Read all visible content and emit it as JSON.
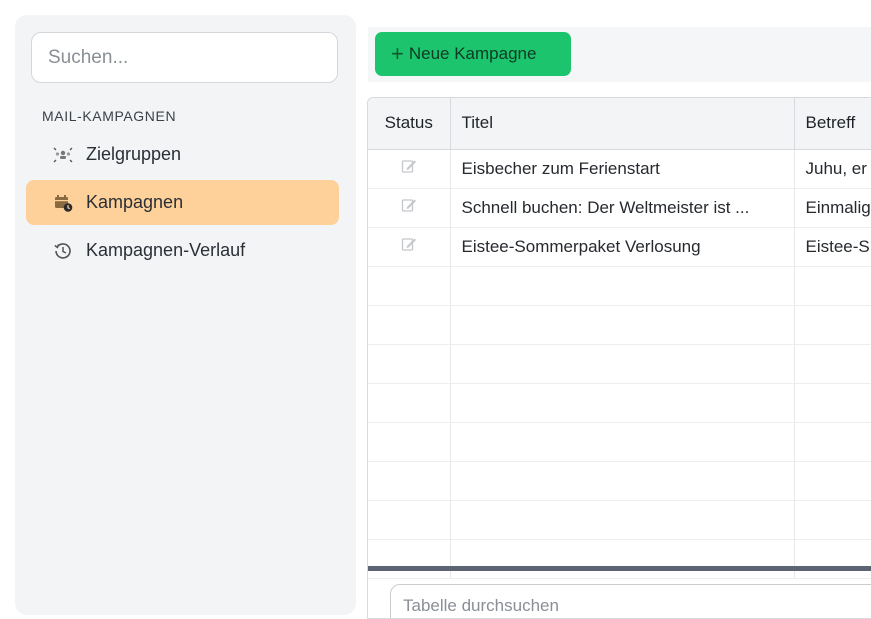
{
  "sidebar": {
    "search_placeholder": "Suchen...",
    "section_title": "MAIL-KAMPAGNEN",
    "items": [
      {
        "label": "Zielgruppen",
        "icon": "audience-icon",
        "active": false
      },
      {
        "label": "Kampagnen",
        "icon": "calendar-clock-icon",
        "active": true
      },
      {
        "label": "Kampagnen-Verlauf",
        "icon": "history-icon",
        "active": false
      }
    ]
  },
  "toolbar": {
    "new_label": "Neue Kampagne"
  },
  "table": {
    "columns": [
      "Status",
      "Titel",
      "Betreff"
    ],
    "rows": [
      {
        "status_icon": "pencil-icon",
        "title": "Eisbecher zum Ferienstart",
        "subject": "Juhu, er"
      },
      {
        "status_icon": "pencil-icon",
        "title": "Schnell buchen: Der Weltmeister ist ...",
        "subject": "Einmalig"
      },
      {
        "status_icon": "pencil-icon",
        "title": "Eistee-Sommerpaket Verlosung",
        "subject": "Eistee-S"
      }
    ],
    "search_placeholder": "Tabelle durchsuchen"
  },
  "colors": {
    "accent_green": "#1cc46e",
    "active_item": "#fdd199",
    "sidebar_bg": "#f3f4f6"
  }
}
